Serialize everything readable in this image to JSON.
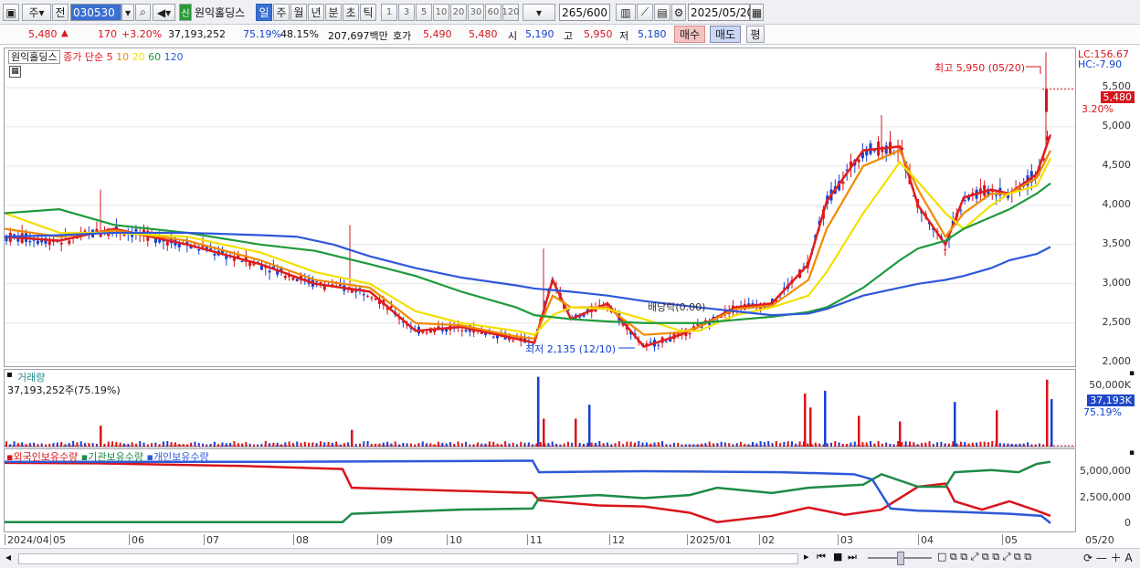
{
  "toolbar": {
    "market_select": "주",
    "prev_label": "전",
    "code": "030530",
    "new_badge": "신",
    "stock_name": "원익홀딩스",
    "period_tabs": [
      "일",
      "주",
      "월",
      "년",
      "분",
      "초",
      "틱"
    ],
    "minute_options": [
      "1",
      "3",
      "5",
      "10",
      "20",
      "30",
      "60",
      "120"
    ],
    "count_value": "265",
    "count_total": "/600",
    "date_value": "2025/05/20"
  },
  "quote": {
    "price": "5,480",
    "change": "170",
    "change_pct": "+3.20%",
    "volume": "37,193,252",
    "vol_ratio": "75.19%",
    "turnover": "48.15%",
    "amount": "207,697백만",
    "hoga_label": "호가",
    "ask": "5,490",
    "bid": "5,480",
    "open_label": "시",
    "open": "5,190",
    "high_label": "고",
    "high": "5,950",
    "low_label": "저",
    "low": "5,180",
    "buy_button": "매수",
    "sell_button": "매도",
    "eval_button": "평"
  },
  "price_pane": {
    "legend_name": "원익홀딩스",
    "legend_ma": "종가 단순",
    "ma_periods": [
      "5",
      "10",
      "20",
      "60",
      "120"
    ],
    "ma_colors": [
      "#e01e1e",
      "#f08a00",
      "#f2e000",
      "#1e9a3a",
      "#2e58d8"
    ],
    "lc_label": "LC:156.67",
    "hc_label": "HC:-7.90",
    "high_annotation": "최고 5,950 (05/20)",
    "low_annotation": "최저 2,135 (12/10)",
    "dividend_annotation": "배당락(0.00)",
    "current_price_tag": "5,480",
    "current_pct_tag": "3.20%",
    "y_labels": [
      "5,500",
      "5,000",
      "4,500",
      "4,000",
      "3,500",
      "3,000",
      "2,500",
      "2,000"
    ]
  },
  "volume_pane": {
    "title": "거래량",
    "value": "37,193,252주(75.19%)",
    "y_label": "50,000K",
    "current_tag": "37,193K",
    "current_pct": "75.19%"
  },
  "holdings_pane": {
    "legend": [
      "외국인보유수량",
      "기관보유수량",
      "개인보유수량"
    ],
    "legend_colors": [
      "#d8141b",
      "#1e8a46",
      "#2e58d8"
    ],
    "y_labels": [
      "5,000,000",
      "2,500,000",
      "0"
    ]
  },
  "x_axis": {
    "labels": [
      "2024/04",
      "05",
      "06",
      "07",
      "08",
      "09",
      "10",
      "11",
      "12",
      "2025/01",
      "02",
      "03",
      "04",
      "05"
    ],
    "right_label": "05/20"
  },
  "chart_data": {
    "type": "line",
    "price_range": [
      1950,
      6000
    ],
    "ma_series": [
      {
        "name": "5",
        "points": [
          [
            0,
            3600
          ],
          [
            60,
            3550
          ],
          [
            120,
            3700
          ],
          [
            200,
            3500
          ],
          [
            280,
            3250
          ],
          [
            340,
            3000
          ],
          [
            400,
            2900
          ],
          [
            450,
            2400
          ],
          [
            500,
            2450
          ],
          [
            560,
            2300
          ],
          [
            580,
            2250
          ],
          [
            600,
            3050
          ],
          [
            620,
            2550
          ],
          [
            660,
            2750
          ],
          [
            700,
            2200
          ],
          [
            740,
            2350
          ],
          [
            760,
            2450
          ],
          [
            800,
            2700
          ],
          [
            840,
            2750
          ],
          [
            880,
            3250
          ],
          [
            900,
            4050
          ],
          [
            940,
            4700
          ],
          [
            980,
            4750
          ],
          [
            1000,
            4000
          ],
          [
            1030,
            3500
          ],
          [
            1050,
            4100
          ],
          [
            1080,
            4200
          ],
          [
            1100,
            4150
          ],
          [
            1130,
            4400
          ],
          [
            1145,
            4900
          ]
        ]
      },
      {
        "name": "10",
        "points": [
          [
            0,
            3700
          ],
          [
            60,
            3600
          ],
          [
            120,
            3680
          ],
          [
            200,
            3550
          ],
          [
            280,
            3300
          ],
          [
            340,
            3050
          ],
          [
            400,
            2950
          ],
          [
            450,
            2500
          ],
          [
            500,
            2470
          ],
          [
            560,
            2330
          ],
          [
            580,
            2300
          ],
          [
            600,
            2850
          ],
          [
            620,
            2700
          ],
          [
            660,
            2700
          ],
          [
            700,
            2350
          ],
          [
            740,
            2380
          ],
          [
            760,
            2450
          ],
          [
            800,
            2680
          ],
          [
            840,
            2720
          ],
          [
            880,
            3050
          ],
          [
            900,
            3700
          ],
          [
            940,
            4500
          ],
          [
            980,
            4700
          ],
          [
            1000,
            4200
          ],
          [
            1030,
            3600
          ],
          [
            1050,
            3900
          ],
          [
            1080,
            4150
          ],
          [
            1100,
            4150
          ],
          [
            1130,
            4350
          ],
          [
            1145,
            4700
          ]
        ]
      },
      {
        "name": "20",
        "points": [
          [
            0,
            3900
          ],
          [
            60,
            3650
          ],
          [
            120,
            3650
          ],
          [
            200,
            3600
          ],
          [
            280,
            3400
          ],
          [
            340,
            3150
          ],
          [
            400,
            3000
          ],
          [
            450,
            2650
          ],
          [
            500,
            2500
          ],
          [
            560,
            2400
          ],
          [
            580,
            2350
          ],
          [
            600,
            2600
          ],
          [
            620,
            2700
          ],
          [
            660,
            2680
          ],
          [
            700,
            2550
          ],
          [
            740,
            2400
          ],
          [
            760,
            2400
          ],
          [
            800,
            2600
          ],
          [
            840,
            2700
          ],
          [
            880,
            2850
          ],
          [
            900,
            3150
          ],
          [
            940,
            3900
          ],
          [
            980,
            4550
          ],
          [
            1000,
            4300
          ],
          [
            1030,
            3900
          ],
          [
            1050,
            3700
          ],
          [
            1080,
            4000
          ],
          [
            1100,
            4150
          ],
          [
            1130,
            4250
          ],
          [
            1145,
            4600
          ]
        ]
      },
      {
        "name": "60",
        "points": [
          [
            0,
            3900
          ],
          [
            60,
            3950
          ],
          [
            120,
            3750
          ],
          [
            200,
            3650
          ],
          [
            280,
            3500
          ],
          [
            340,
            3420
          ],
          [
            400,
            3250
          ],
          [
            450,
            3100
          ],
          [
            500,
            2900
          ],
          [
            560,
            2700
          ],
          [
            580,
            2600
          ],
          [
            620,
            2550
          ],
          [
            660,
            2520
          ],
          [
            700,
            2500
          ],
          [
            760,
            2500
          ],
          [
            800,
            2540
          ],
          [
            840,
            2580
          ],
          [
            880,
            2640
          ],
          [
            900,
            2700
          ],
          [
            940,
            2950
          ],
          [
            980,
            3300
          ],
          [
            1000,
            3450
          ],
          [
            1030,
            3550
          ],
          [
            1050,
            3700
          ],
          [
            1080,
            3850
          ],
          [
            1100,
            3950
          ],
          [
            1130,
            4150
          ],
          [
            1145,
            4280
          ]
        ]
      },
      {
        "name": "120",
        "points": [
          [
            0,
            3600
          ],
          [
            60,
            3620
          ],
          [
            120,
            3650
          ],
          [
            200,
            3650
          ],
          [
            280,
            3620
          ],
          [
            320,
            3600
          ],
          [
            360,
            3500
          ],
          [
            400,
            3350
          ],
          [
            450,
            3200
          ],
          [
            500,
            3080
          ],
          [
            560,
            2980
          ],
          [
            580,
            2940
          ],
          [
            620,
            2900
          ],
          [
            660,
            2850
          ],
          [
            700,
            2780
          ],
          [
            760,
            2700
          ],
          [
            800,
            2650
          ],
          [
            840,
            2600
          ],
          [
            880,
            2620
          ],
          [
            900,
            2680
          ],
          [
            940,
            2850
          ],
          [
            980,
            2950
          ],
          [
            1000,
            3000
          ],
          [
            1030,
            3050
          ],
          [
            1050,
            3100
          ],
          [
            1080,
            3200
          ],
          [
            1100,
            3300
          ],
          [
            1130,
            3380
          ],
          [
            1145,
            3470
          ]
        ]
      }
    ],
    "holdings_range": [
      0,
      6500000
    ],
    "holdings_series": [
      {
        "name": "외국인보유수량",
        "points": [
          [
            0,
            5900000
          ],
          [
            100,
            5850000
          ],
          [
            260,
            5600000
          ],
          [
            370,
            5300000
          ],
          [
            380,
            3500000
          ],
          [
            500,
            3200000
          ],
          [
            578,
            3000000
          ],
          [
            585,
            2300000
          ],
          [
            650,
            1800000
          ],
          [
            700,
            1700000
          ],
          [
            750,
            1100000
          ],
          [
            780,
            200000
          ],
          [
            840,
            800000
          ],
          [
            880,
            1600000
          ],
          [
            920,
            900000
          ],
          [
            960,
            1400000
          ],
          [
            1000,
            3600000
          ],
          [
            1030,
            3900000
          ],
          [
            1040,
            2200000
          ],
          [
            1070,
            1400000
          ],
          [
            1100,
            2200000
          ],
          [
            1130,
            1300000
          ],
          [
            1145,
            800000
          ]
        ]
      },
      {
        "name": "기관보유수량",
        "points": [
          [
            0,
            200000
          ],
          [
            100,
            200000
          ],
          [
            370,
            200000
          ],
          [
            380,
            1000000
          ],
          [
            500,
            1400000
          ],
          [
            578,
            1500000
          ],
          [
            585,
            2500000
          ],
          [
            650,
            2800000
          ],
          [
            700,
            2500000
          ],
          [
            750,
            2800000
          ],
          [
            780,
            3500000
          ],
          [
            840,
            3000000
          ],
          [
            880,
            3500000
          ],
          [
            940,
            3800000
          ],
          [
            960,
            4800000
          ],
          [
            1000,
            3600000
          ],
          [
            1030,
            3600000
          ],
          [
            1040,
            5000000
          ],
          [
            1080,
            5200000
          ],
          [
            1110,
            5000000
          ],
          [
            1130,
            5800000
          ],
          [
            1145,
            6000000
          ]
        ]
      },
      {
        "name": "개인보유수량",
        "points": [
          [
            0,
            6000000
          ],
          [
            300,
            6000000
          ],
          [
            578,
            6100000
          ],
          [
            585,
            5000000
          ],
          [
            700,
            5100000
          ],
          [
            850,
            5000000
          ],
          [
            930,
            4800000
          ],
          [
            950,
            4300000
          ],
          [
            970,
            1500000
          ],
          [
            1000,
            1300000
          ],
          [
            1040,
            1200000
          ],
          [
            1100,
            1000000
          ],
          [
            1135,
            800000
          ],
          [
            1145,
            100000
          ]
        ]
      }
    ],
    "volume_spikes": [
      [
        105,
        15000
      ],
      [
        380,
        12000
      ],
      [
        584,
        50000
      ],
      [
        590,
        20000
      ],
      [
        625,
        20000
      ],
      [
        640,
        30000
      ],
      [
        876,
        38000
      ],
      [
        882,
        28000
      ],
      [
        898,
        40000
      ],
      [
        935,
        22000
      ],
      [
        980,
        18000
      ],
      [
        1040,
        32000
      ],
      [
        1086,
        26000
      ],
      [
        1141,
        48000
      ],
      [
        1146,
        34000
      ]
    ]
  }
}
